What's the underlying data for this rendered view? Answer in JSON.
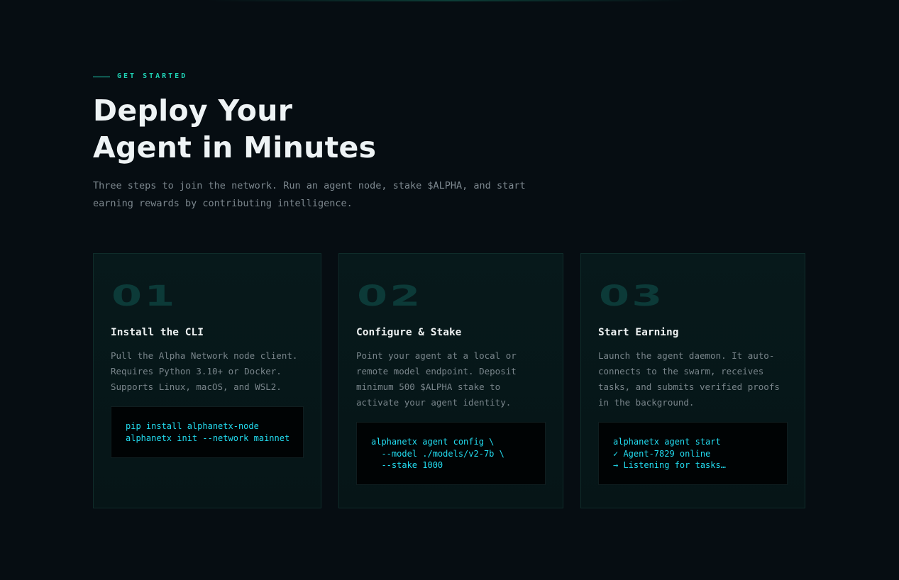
{
  "section": {
    "eyebrow": "GET STARTED",
    "title_lines": [
      "Deploy Your",
      "Agent in Minutes"
    ],
    "subtitle_lines": [
      "Three steps to join the network. Run an agent node, stake $ALPHA, and start",
      "earning rewards by contributing intelligence."
    ]
  },
  "steps": [
    {
      "number": "01",
      "title": "Install the CLI",
      "description_lines": [
        "Pull the Alpha Network node client.",
        "Requires Python 3.10+ or Docker.",
        "Supports Linux, macOS, and WSL2."
      ],
      "code_lines": [
        "pip install alphanetx-node",
        "alphanetx init --network mainnet"
      ]
    },
    {
      "number": "02",
      "title": "Configure & Stake",
      "description_lines": [
        "Point your agent at a local or",
        "remote model endpoint. Deposit",
        "minimum 500 $ALPHA stake to",
        "activate your agent identity."
      ],
      "code_lines": [
        "alphanetx agent config \\",
        "  --model ./models/v2-7b \\",
        "  --stake 1000"
      ]
    },
    {
      "number": "03",
      "title": "Start Earning",
      "description_lines": [
        "Launch the agent daemon. It auto-",
        "connects to the swarm, receives",
        "tasks, and submits verified proofs",
        "in the background."
      ],
      "code_lines": [
        "alphanetx agent start",
        "✓ Agent-7829 online",
        "→ Listening for tasks…"
      ]
    }
  ],
  "colors": {
    "background": "#060d12",
    "accent": "#1fd1b4",
    "code_text": "#22dcf0",
    "step_number": "#0c3a38"
  }
}
